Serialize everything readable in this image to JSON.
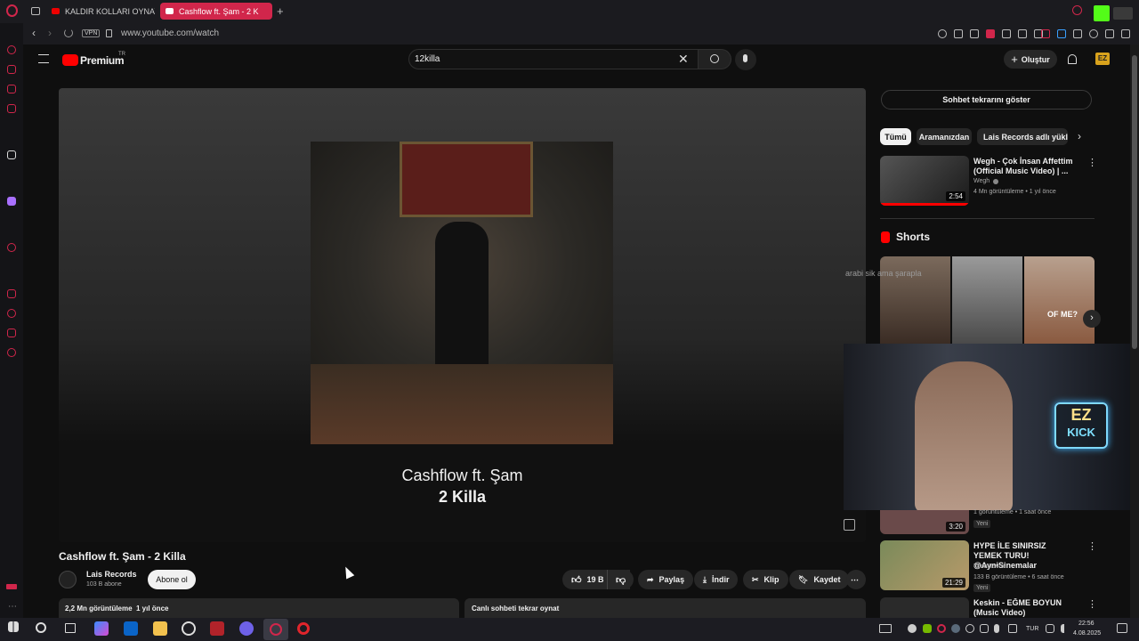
{
  "browser": {
    "tabs": [
      {
        "label": "KALDIR KOLLARI OYNAYA",
        "active": false
      },
      {
        "label": "Cashflow ft. Şam - 2 K",
        "active": true
      }
    ],
    "new_tab": "+",
    "vpn_badge": "VPN",
    "url": "www.youtube.com/watch",
    "accent": "#d1264b"
  },
  "youtube": {
    "logo_text": "Premium",
    "logo_sup": "TR",
    "search_value": "12killa",
    "create_label": "Oluştur",
    "avatar_text": "EZ"
  },
  "video": {
    "overlay_line1": "Cashflow ft. Şam",
    "overlay_line2": "2 Killa",
    "title": "Cashflow ft. Şam - 2 Killa",
    "channel": "Lais Records",
    "subscribers": "103 B abone",
    "subscribe_label": "Abone ol",
    "likes": "19 B",
    "share_label": "Paylaş",
    "download_label": "İndir",
    "clip_label": "Klip",
    "save_label": "Kaydet",
    "more_label": "⋯",
    "description_stats": "2,2 Mn görüntüleme  1 yıl önce",
    "chat_replay_label": "Canlı sohbeti tekrar oynat"
  },
  "sidebar_right": {
    "show_chat_label": "Sohbet tekrarını göster",
    "chips": [
      "Tümü",
      "Aramanızdan",
      "Lais Records adlı yükleyici"
    ],
    "shorts_label": "Shorts",
    "short_captions": [
      "",
      "",
      "OF ME?"
    ],
    "recommendations": [
      {
        "title": "Wegh - Çok İnsan Affettim (Official Music Video) | ...",
        "channel": "Wegh",
        "meta": "4 Mn görüntüleme • 1 yıl önce",
        "duration": "2:54"
      },
      {
        "title": "",
        "channel": "",
        "meta": "1 görüntüleme • 1 saat önce",
        "duration": "3:20",
        "badge": "Yeni"
      },
      {
        "title": "HYPE İLE SINIRSIZ YEMEK TURU! @AyniSinemalar",
        "channel": "Tuna Tavus",
        "meta": "133 B görüntüleme • 6 saat önce",
        "duration": "21:29",
        "badge": "Yeni"
      },
      {
        "title": "Keskin - EĞME BOYUN (Music Video)",
        "channel": "",
        "meta": "",
        "duration": ""
      }
    ]
  },
  "chat_overlay": {
    "text": "arabi sik ama şarapla"
  },
  "webcam": {
    "logo_top": "EZ",
    "logo_bottom": "KICK"
  },
  "taskbar": {
    "language": "TUR",
    "time": "22:56",
    "date": "4.08.2025"
  }
}
